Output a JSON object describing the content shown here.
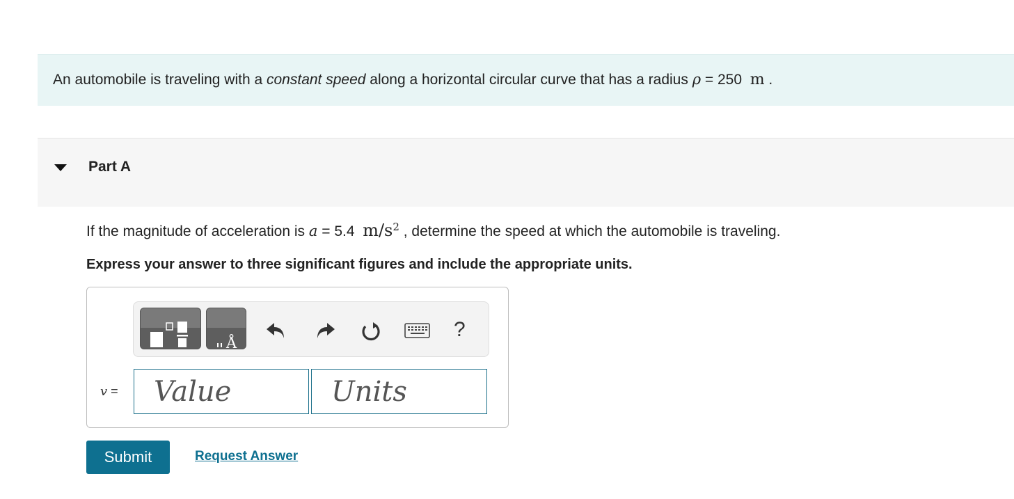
{
  "problem": {
    "intro_before": "An automobile is traveling with a ",
    "intro_emphasis": "constant speed",
    "intro_after": " along a horizontal circular curve that has a radius ",
    "radius_symbol": "ρ",
    "radius_eq": " = 250 ",
    "radius_unit": "m",
    "intro_end": " ."
  },
  "part": {
    "title": "Part A",
    "expanded": true
  },
  "question": {
    "before": "If the magnitude of acceleration is ",
    "symbol": "a",
    "eq": " = 5.4 ",
    "unit": "m/s",
    "unit_exp": "2",
    "after": " , determine the speed at which the automobile is traveling."
  },
  "instruction": "Express your answer to three significant figures and include the appropriate units.",
  "answer": {
    "variable": "v",
    "equals": " =",
    "value_placeholder": "Value",
    "units_placeholder": "Units"
  },
  "toolbar": {
    "buttons": [
      "fraction-template-icon",
      "units-template-icon",
      "undo-icon",
      "redo-icon",
      "reset-icon",
      "keyboard-icon",
      "help-icon"
    ],
    "help_label": "?",
    "units_glyph": "Å"
  },
  "actions": {
    "submit_label": "Submit",
    "request_label": "Request Answer"
  },
  "colors": {
    "intro_bg": "#e8f5f5",
    "part_bg": "#f6f6f6",
    "accent": "#0e7090"
  }
}
